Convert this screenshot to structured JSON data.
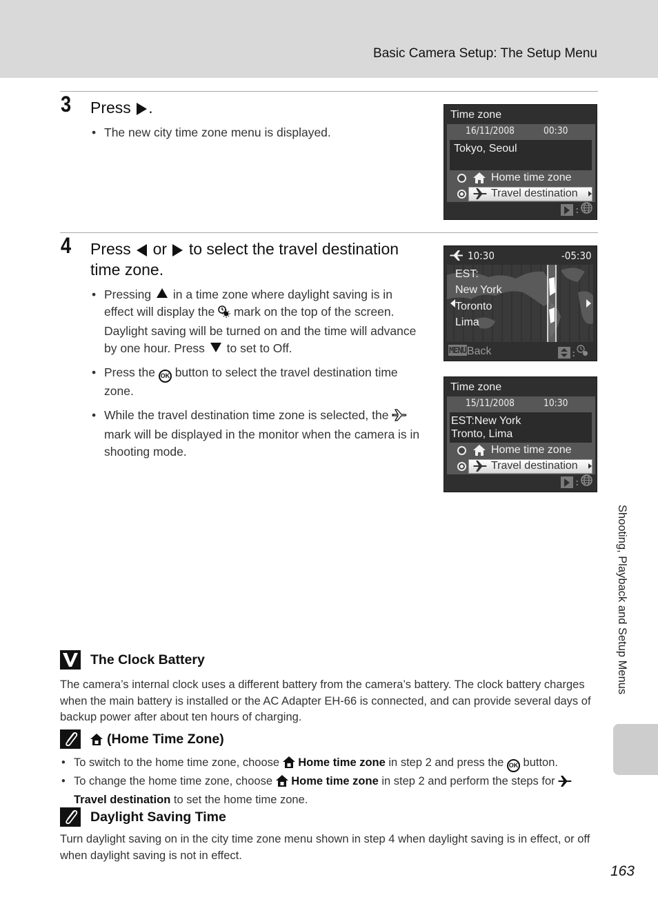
{
  "header": {
    "title": "Basic Camera Setup: The Setup Menu"
  },
  "step3": {
    "number": "3",
    "title_pre": "Press",
    "title_post": ".",
    "bullets": [
      "The new city time zone menu is displayed."
    ]
  },
  "step4": {
    "number": "4",
    "title_a": "Press",
    "title_b": "or",
    "title_c": "to select the travel destination time zone.",
    "bullet1_a": "Pressing",
    "bullet1_b": "in a time zone where daylight saving is in effect will display the",
    "bullet1_c": "mark on the top of the screen. Daylight saving will be turned on and the time will advance by one hour. Press",
    "bullet1_d": "to set to Off.",
    "bullet2_a": "Press the",
    "bullet2_b": "button to select the travel destination time zone.",
    "bullet3_a": "While the travel destination time zone is selected, the",
    "bullet3_b": "mark will be displayed in the monitor when the camera is in shooting mode.",
    "ok_label": "OK"
  },
  "screens": {
    "screen1": {
      "title": "Time zone",
      "date": "16/11/2008",
      "time": "00:30",
      "city_line1": "Tokyo, Seoul",
      "city_line2": "",
      "option_home": "Home time zone",
      "option_travel": "Travel destination",
      "selected": "Travel destination"
    },
    "screen2": {
      "time": "10:30",
      "offset": "-05:30",
      "cities": [
        "EST:",
        "New York",
        "Toronto",
        "Lima"
      ],
      "menu_key": "MENU",
      "back_label": "Back"
    },
    "screen3": {
      "title": "Time zone",
      "date": "15/11/2008",
      "time": "10:30",
      "city_line1": "EST:New York",
      "city_line2": "Tronto, Lima",
      "option_home": "Home time zone",
      "option_travel": "Travel destination",
      "selected": "Travel destination"
    }
  },
  "notes": {
    "clock_battery": {
      "title": "The Clock Battery",
      "text": "The camera’s internal clock uses a different battery from the camera’s battery. The clock battery charges when the main battery is installed or the AC Adapter EH-66 is connected, and can provide several days of backup power after about ten hours of charging."
    },
    "home_time_zone": {
      "title": "(Home Time Zone)",
      "b1_a": "To switch to the home time zone, choose",
      "b1_bold": "Home time zone",
      "b1_b": "in step 2 and press the",
      "b1_c": "button.",
      "b2_a": "To change the home time zone, choose",
      "b2_bold": "Home time zone",
      "b2_b": "in step 2 and perform the steps for",
      "b2_bold2": "Travel destination",
      "b2_c": "to set the home time zone."
    },
    "daylight_saving": {
      "title": "Daylight Saving Time",
      "text": "Turn daylight saving on in the city time zone menu shown in step 4 when daylight saving is in effect, or off when daylight saving is not in effect."
    }
  },
  "side_label": "Shooting, Playback and Setup Menus",
  "page_number": "163"
}
